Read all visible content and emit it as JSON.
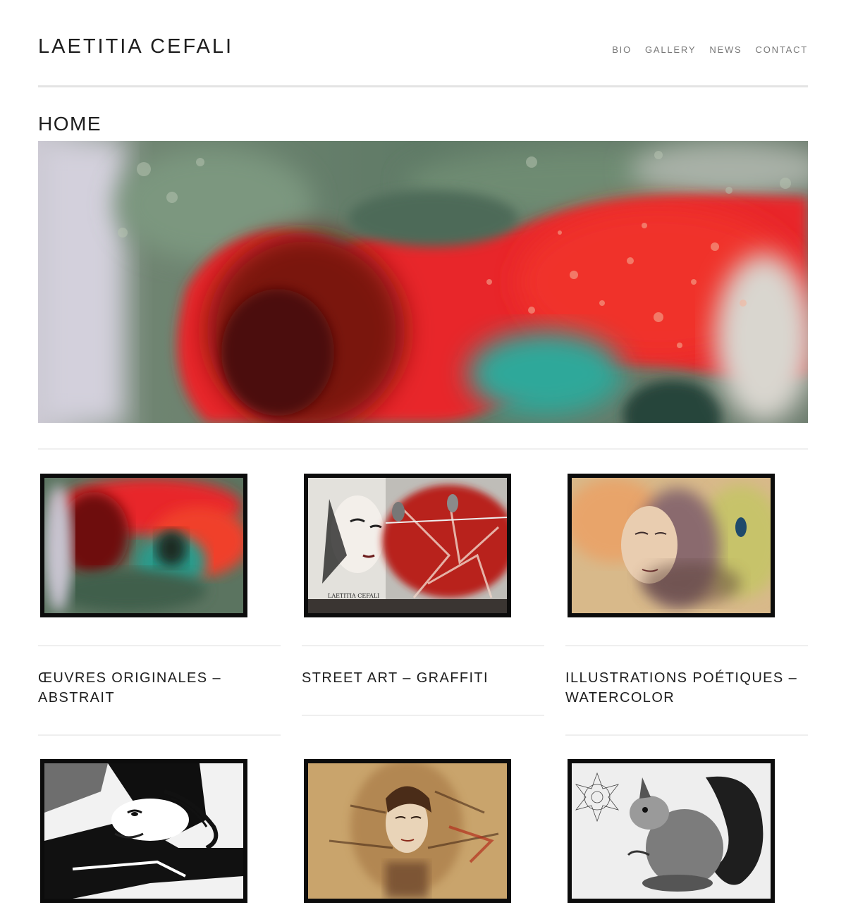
{
  "site": {
    "title": "LAETITIA CEFALI"
  },
  "nav": {
    "items": [
      {
        "label": "BIO"
      },
      {
        "label": "GALLERY"
      },
      {
        "label": "NEWS"
      },
      {
        "label": "CONTACT"
      }
    ]
  },
  "page": {
    "title": "HOME"
  },
  "gallery": {
    "row1": [
      {
        "title": "ŒUVRES ORIGINALES – ABSTRAIT"
      },
      {
        "title": "STREET ART – GRAFFITI"
      },
      {
        "title": "ILLUSTRATIONS POÉTIQUES – WATERCOLOR"
      }
    ],
    "signature": "LAETITIA CEFALI"
  },
  "colors": {
    "accent_red": "#e8262a",
    "deep_green": "#4f6d5a",
    "frame_black": "#0c0c0c"
  }
}
